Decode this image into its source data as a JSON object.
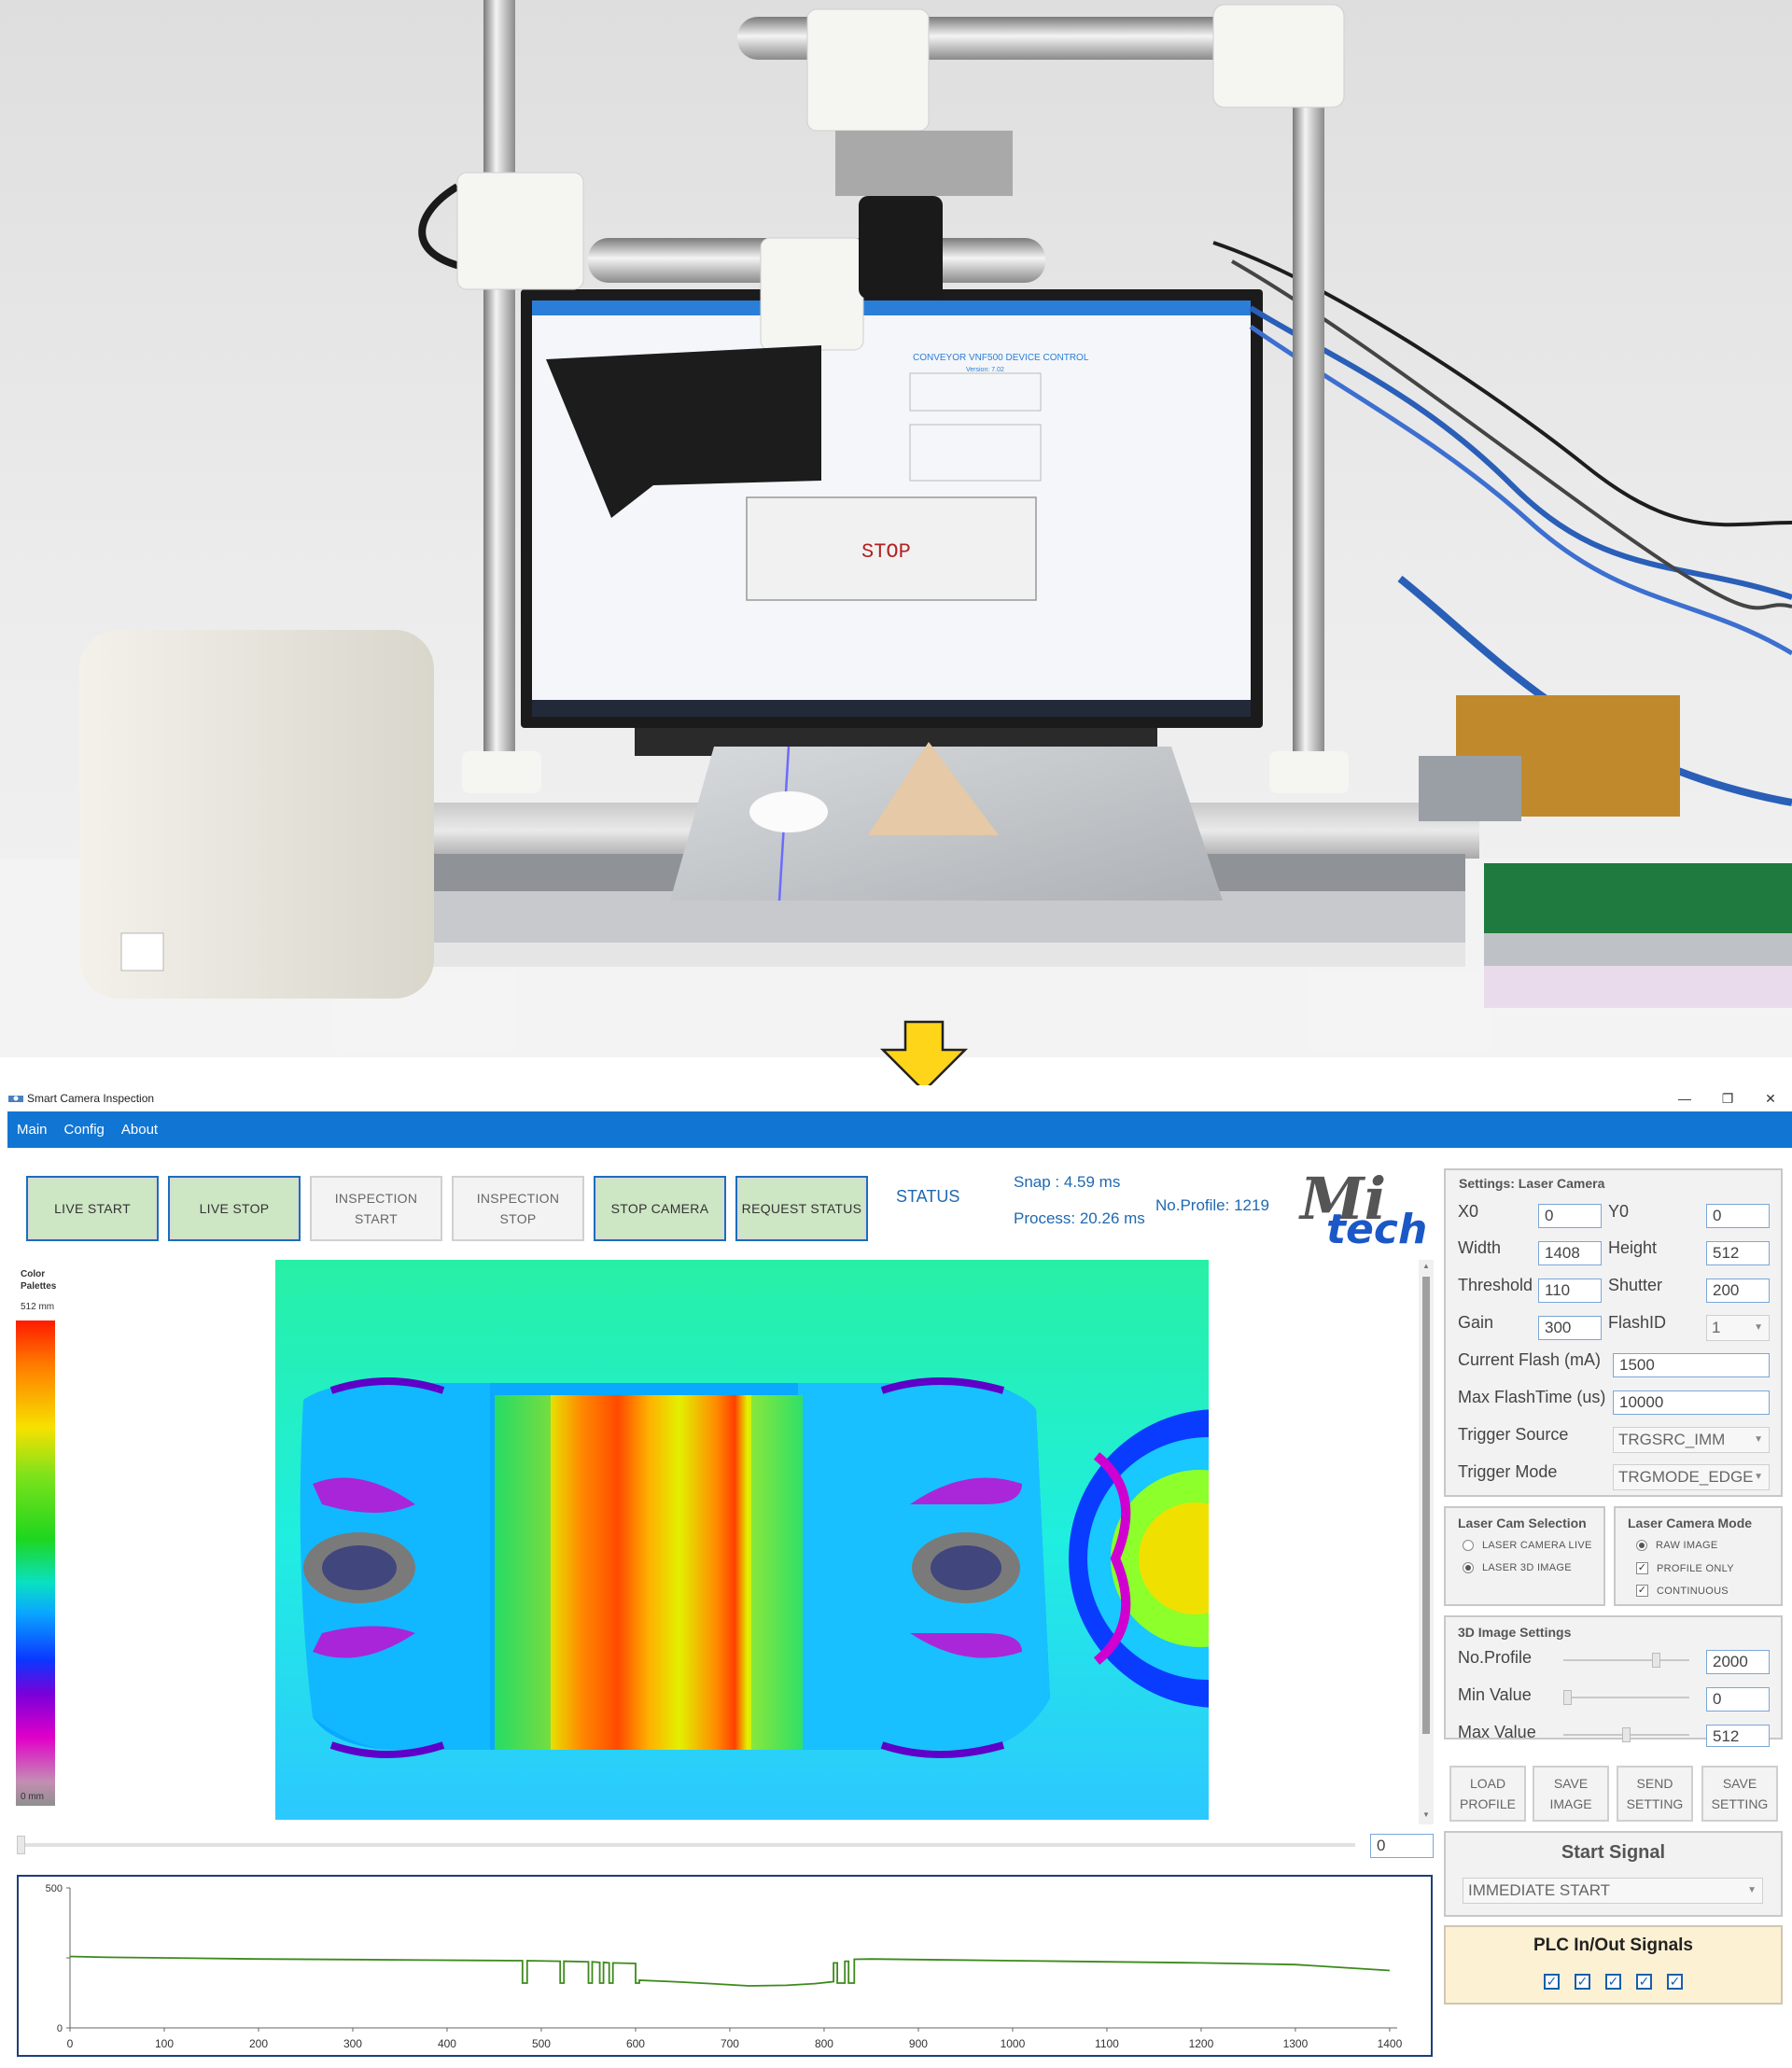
{
  "window": {
    "title": "Smart Camera Inspection",
    "controls": {
      "minimize": "—",
      "maximize": "❐",
      "close": "✕"
    }
  },
  "menu": [
    "Main",
    "Config",
    "About"
  ],
  "photo": {
    "monitor_title": "CONVEYOR VNF500 DEVICE CONTROL",
    "monitor_version": "Version: 7.02",
    "monitor_stop": "STOP"
  },
  "toolbar": {
    "live_start": "LIVE START",
    "live_stop": "LIVE STOP",
    "inspection_start_1": "INSPECTION",
    "inspection_start_2": "START",
    "inspection_stop_1": "INSPECTION",
    "inspection_stop_2": "STOP",
    "stop_camera": "STOP CAMERA",
    "request_status": "REQUEST STATUS"
  },
  "status": {
    "label": "STATUS",
    "snap": "Snap   : 4.59 ms",
    "process": "Process: 20.26 ms",
    "no_profile": "No.Profile: 1219"
  },
  "logo": {
    "line1": "Mi",
    "line2": "tech"
  },
  "palette": {
    "title_1": "Color",
    "title_2": "Palettes",
    "max": "512 mm",
    "min": "0 mm"
  },
  "image_slider_value": "0",
  "laser_settings": {
    "title": "Settings: Laser Camera",
    "x0_label": "X0",
    "x0": "0",
    "y0_label": "Y0",
    "y0": "0",
    "width_label": "Width",
    "width": "1408",
    "height_label": "Height",
    "height": "512",
    "threshold_label": "Threshold",
    "threshold": "110",
    "shutter_label": "Shutter",
    "shutter": "200",
    "gain_label": "Gain",
    "gain": "300",
    "flashid_label": "FlashID",
    "flashid": "1",
    "current_flash_label": "Current Flash (mA)",
    "current_flash": "1500",
    "max_flashtime_label": "Max FlashTime (us)",
    "max_flashtime": "10000",
    "trigger_source_label": "Trigger Source",
    "trigger_source": "TRGSRC_IMM",
    "trigger_mode_label": "Trigger Mode",
    "trigger_mode": "TRGMODE_EDGE"
  },
  "cam_selection": {
    "title": "Laser Cam Selection",
    "opt_live": "LASER CAMERA LIVE",
    "opt_3d": "LASER 3D IMAGE"
  },
  "cam_mode": {
    "title": "Laser Camera Mode",
    "raw_image": "RAW IMAGE",
    "profile_only": "PROFILE ONLY",
    "continuous": "CONTINUOUS"
  },
  "image_settings": {
    "title": "3D Image Settings",
    "no_profile_label": "No.Profile",
    "no_profile": "2000",
    "no_profile_pos": 0.75,
    "min_label": "Min Value",
    "min": "0",
    "min_pos": 0.0,
    "max_label": "Max Value",
    "max": "512",
    "max_pos": 0.5
  },
  "actions": {
    "load_1": "LOAD",
    "load_2": "PROFILE",
    "save_img_1": "SAVE",
    "save_img_2": "IMAGE",
    "send_1": "SEND",
    "send_2": "SETTING",
    "save_set_1": "SAVE",
    "save_set_2": "SETTING"
  },
  "start_signal": {
    "title": "Start Signal",
    "value": "IMMEDIATE START"
  },
  "plc": {
    "title": "PLC In/Out Signals",
    "checks": [
      true,
      true,
      true,
      true,
      true
    ]
  },
  "chart_data": {
    "type": "line",
    "title": "",
    "xlabel": "",
    "ylabel": "",
    "xlim": [
      0,
      1408
    ],
    "ylim": [
      0,
      500
    ],
    "x_ticks": [
      0,
      100,
      200,
      300,
      400,
      500,
      600,
      700,
      800,
      900,
      1000,
      1100,
      1200,
      1300,
      1400
    ],
    "y_ticks": [
      0,
      250,
      500
    ],
    "y_tick_labels": [
      "0",
      "",
      "500"
    ],
    "series": [
      {
        "color": "#3d8a1c",
        "points": [
          [
            0,
            255
          ],
          [
            40,
            252
          ],
          [
            100,
            250
          ],
          [
            200,
            246
          ],
          [
            300,
            244
          ],
          [
            380,
            242
          ],
          [
            480,
            240
          ],
          [
            480,
            160
          ],
          [
            485,
            160
          ],
          [
            485,
            240
          ],
          [
            520,
            238
          ],
          [
            520,
            160
          ],
          [
            524,
            160
          ],
          [
            524,
            238
          ],
          [
            550,
            236
          ],
          [
            550,
            160
          ],
          [
            554,
            160
          ],
          [
            554,
            236
          ],
          [
            562,
            234
          ],
          [
            562,
            160
          ],
          [
            566,
            160
          ],
          [
            566,
            234
          ],
          [
            572,
            232
          ],
          [
            572,
            160
          ],
          [
            576,
            160
          ],
          [
            576,
            232
          ],
          [
            600,
            230
          ],
          [
            600,
            160
          ],
          [
            604,
            160
          ],
          [
            604,
            170
          ],
          [
            640,
            165
          ],
          [
            680,
            158
          ],
          [
            720,
            150
          ],
          [
            760,
            152
          ],
          [
            790,
            158
          ],
          [
            810,
            165
          ],
          [
            810,
            232
          ],
          [
            814,
            232
          ],
          [
            814,
            160
          ],
          [
            822,
            160
          ],
          [
            822,
            238
          ],
          [
            826,
            238
          ],
          [
            826,
            160
          ],
          [
            832,
            160
          ],
          [
            832,
            245
          ],
          [
            850,
            246
          ],
          [
            900,
            244
          ],
          [
            1000,
            240
          ],
          [
            1100,
            236
          ],
          [
            1200,
            232
          ],
          [
            1300,
            226
          ],
          [
            1400,
            205
          ]
        ]
      }
    ]
  },
  "colors": {
    "accent": "#1176d3",
    "button_green": "#cde6c4",
    "plc_bg": "#fdf1d4",
    "series": "#3d8a1c"
  }
}
